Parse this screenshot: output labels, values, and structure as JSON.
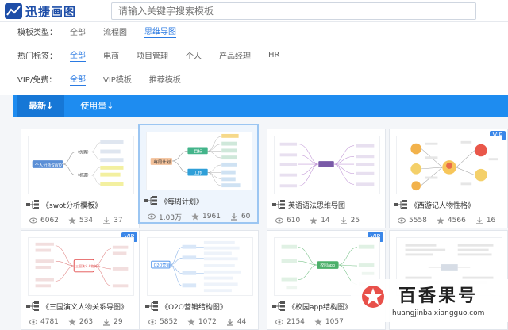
{
  "app": {
    "logo_text": "迅捷画图"
  },
  "search": {
    "placeholder": "请输入关键字搜索模板"
  },
  "filters": [
    {
      "label": "模板类型：",
      "options": [
        "全部",
        "流程图",
        "思维导图"
      ],
      "active": 2
    },
    {
      "label": "热门标签：",
      "options": [
        "全部",
        "电商",
        "项目管理",
        "个人",
        "产品经理",
        "HR"
      ],
      "active": 0
    },
    {
      "label": "VIP/免费：",
      "options": [
        "全部",
        "VIP模板",
        "推荐模板"
      ],
      "active": 0
    }
  ],
  "sort": {
    "newest": "最新↓",
    "usage": "使用量↓"
  },
  "cards": [
    {
      "title": "《swot分析模板》",
      "views": "6062",
      "favs": "534",
      "third": "37",
      "vip": false
    },
    {
      "title": "《每周计划》",
      "views": "1.03万",
      "favs": "1961",
      "third": "60",
      "vip": false
    },
    {
      "title": "英语语法思维导图",
      "views": "610",
      "favs": "14",
      "third": "25",
      "vip": false
    },
    {
      "title": "《西游记人物性格》",
      "views": "5558",
      "favs": "4566",
      "third": "16",
      "vip": true
    },
    {
      "title": "《三国演义人物关系导图》",
      "views": "4781",
      "favs": "263",
      "third": "29",
      "vip": true
    },
    {
      "title": "《O2O营销结构图》",
      "views": "5852",
      "favs": "1072",
      "third": "44",
      "vip": false
    },
    {
      "title": "《校园app结构图》",
      "views": "2154",
      "favs": "1057",
      "third": "",
      "vip": true
    },
    {
      "title": "",
      "views": "",
      "favs": "",
      "third": "",
      "vip": false
    }
  ],
  "vip_label": "VIP",
  "thumb_text": {
    "swot_center": "个人分析SWOT",
    "swot_a": "（优势）",
    "swot_b": "（机遇）",
    "weekly_center": "每周计划",
    "weekly_a": "目标",
    "weekly_b": "工作",
    "sanguo_center": "三国演义人物关系",
    "o2o_center": "O2O营销",
    "campus_center": "校园app"
  },
  "watermark": {
    "title": "百香果号",
    "url": "huangjinbaixiangguo.com"
  },
  "colors": {
    "accent": "#1e8cf0",
    "link": "#2a7ae2",
    "logo": "#1e4ea8",
    "vip": "#3a86e8"
  }
}
